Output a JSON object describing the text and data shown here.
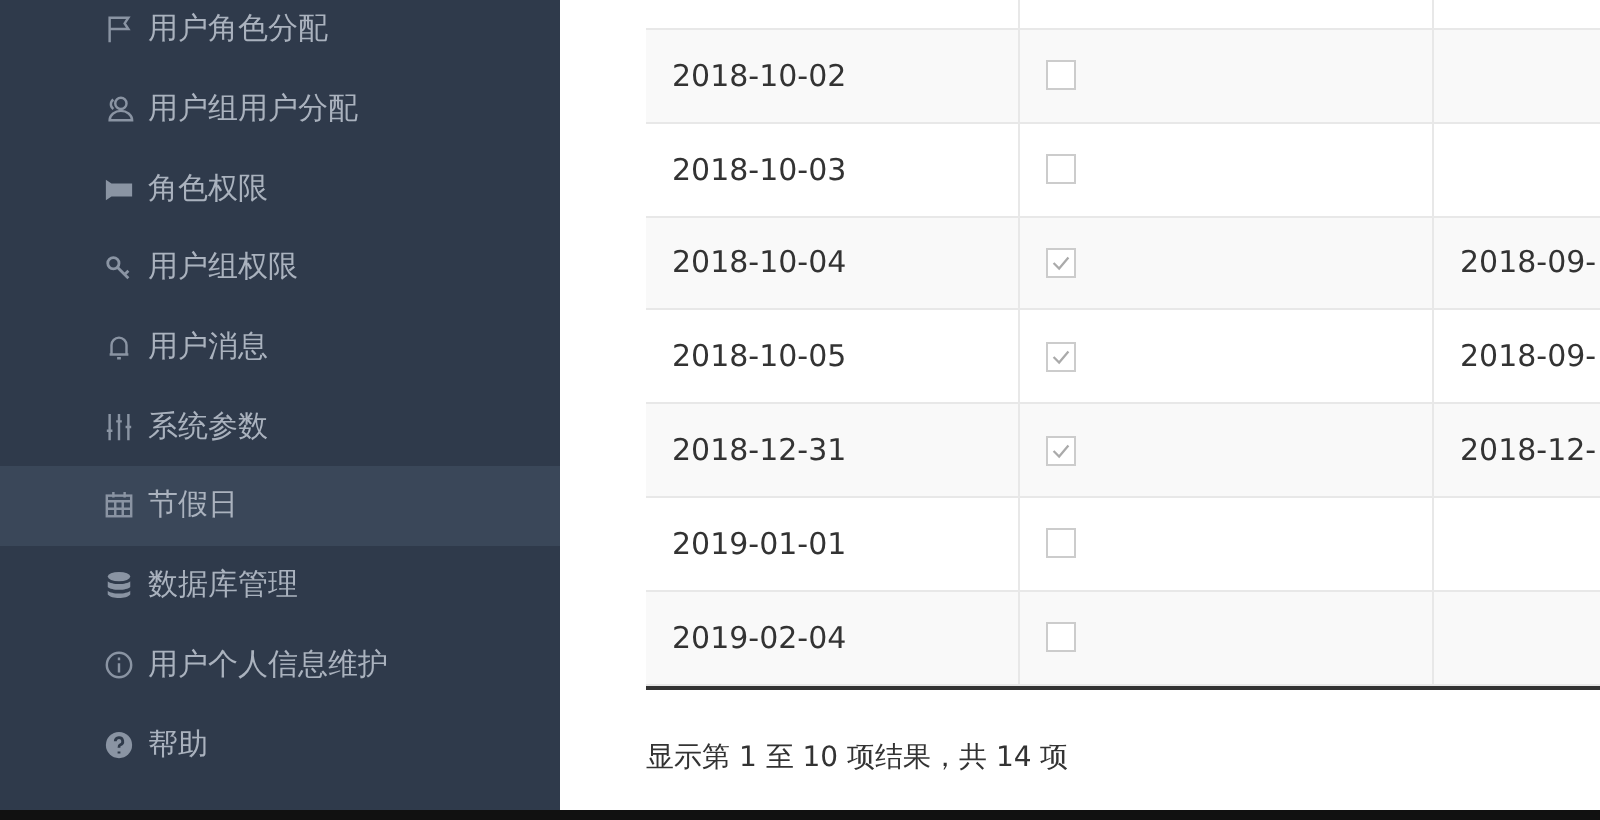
{
  "sidebar": {
    "items": [
      {
        "label": "用户角色分配",
        "selected": false
      },
      {
        "label": "用户组用户分配",
        "selected": false
      },
      {
        "label": "角色权限",
        "selected": false
      },
      {
        "label": "用户组权限",
        "selected": false
      },
      {
        "label": "用户消息",
        "selected": false
      },
      {
        "label": "系统参数",
        "selected": false
      },
      {
        "label": "节假日",
        "selected": true
      },
      {
        "label": "数据库管理",
        "selected": false
      },
      {
        "label": "用户个人信息维护",
        "selected": false
      },
      {
        "label": "帮助",
        "selected": false
      }
    ]
  },
  "table": {
    "rows": [
      {
        "date": "2018-10-02",
        "checked": false
      },
      {
        "date": "2018-10-03",
        "checked": false
      },
      {
        "date": "2018-10-04",
        "checked": true,
        "column_3": "2018-09-"
      },
      {
        "date": "2018-10-05",
        "checked": true,
        "column_3": "2018-09-"
      },
      {
        "date": "2018-12-31",
        "checked": true,
        "column_3": "2018-12-"
      },
      {
        "date": "2019-01-01",
        "checked": false
      },
      {
        "date": "2019-02-04",
        "checked": false
      }
    ]
  },
  "footer": {
    "summary": "显示第 1 至 10 项结果，共 14 项"
  }
}
